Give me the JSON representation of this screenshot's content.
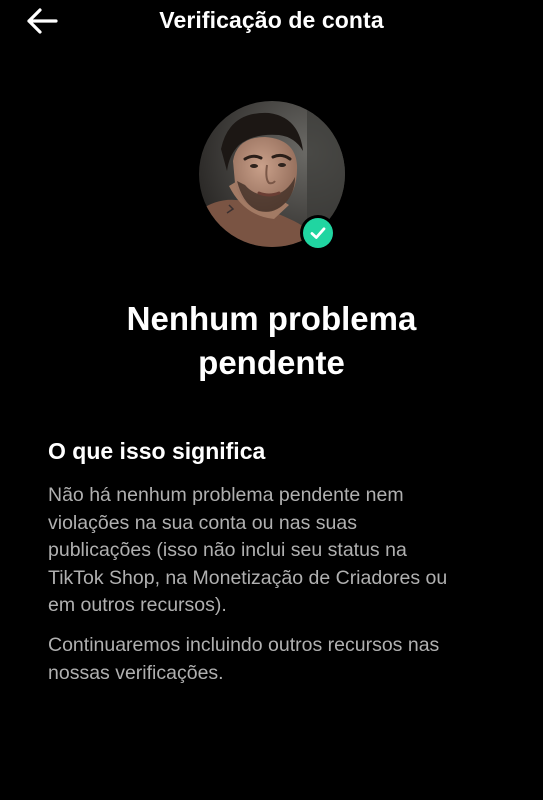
{
  "header": {
    "title": "Verificação de conta",
    "back_icon": "arrow-left-icon"
  },
  "profile": {
    "avatar_icon": "profile-avatar",
    "badge_icon": "check-icon",
    "badge_color": "#20d5a1"
  },
  "status": {
    "headline_lines": [
      "Nenhum problema",
      "pendente"
    ]
  },
  "info": {
    "title": "O que isso significa",
    "paragraph1_lines": [
      "Não há nenhum problema pendente nem",
      "violações na sua conta ou nas suas",
      "publicações (isso não inclui seu status na",
      "TikTok Shop, na Monetização de Criadores ou",
      "em outros recursos)."
    ],
    "paragraph2_lines": [
      "Continuaremos incluindo outros recursos nas",
      "nossas verificações."
    ]
  },
  "colors": {
    "background": "#000000",
    "text_primary": "#ffffff",
    "text_secondary": "#b0b0b0"
  }
}
